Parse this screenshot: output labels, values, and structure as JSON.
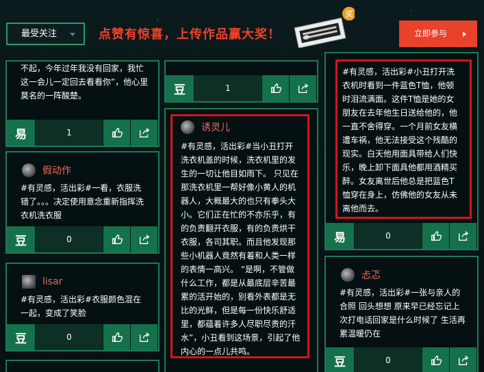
{
  "header": {
    "sort_label": "最受关注",
    "promo_text": "点赞有惊喜，上传作品赢大奖！",
    "prize_badge": "奖",
    "join_label": "立即参与"
  },
  "colors": {
    "accent_green": "#15704c",
    "border_green": "#1f7a55",
    "red": "#e8422b",
    "highlight": "#d4151d"
  },
  "cards": [
    {
      "id": "c1",
      "text": "不起，今年过年我没有回家，我忙这一会儿一定回去看看你”，他心里莫名的一阵酸楚。",
      "top_partial": "...",
      "count": "1",
      "logo": "易"
    },
    {
      "id": "c2",
      "user": "假动作",
      "text": "#有灵感，活出彩#一看，衣服洗错了。。。决定使用意念重新指挥洗衣机洗衣服",
      "count": "0",
      "logo": "豆"
    },
    {
      "id": "c3",
      "user": "lisar",
      "text": "#有灵感，活出彩#衣服颜色混在一起，变成了笑脸",
      "count": "0",
      "logo": "豆"
    },
    {
      "id": "c4",
      "count": "1",
      "logo": "豆"
    },
    {
      "id": "c5",
      "user": "诱灵儿",
      "text": "#有灵感，活出彩#当小丑打开洗衣机盖的时候，洗衣机里的发生的一切让他目如雨下。 只见在那洗衣机里一帮好像小黄人的机器人，大概最大的也只有拳头大小。它们正在忙的不亦乐乎，有的负责翻开衣服，有的负责烘干衣服，各司其职。而且他发现那些小机器人竟然有着和人类一样的表情一高兴。 “是啊，不管做什么工作，都是从最底层辛苦最累的活开始的，别看外表都是无比的光鲜，但是每一份快乐舒适里，都蕴着许多人尽职尽责的汗水”，小丑看到这场景，引起了他内心的一点儿共鸣。"
    },
    {
      "id": "c6",
      "text": "#有灵感，活出彩#小丑打开洗衣机时看到一件蓝色T恤，他顿时泪流满面。这件T恤是她的女朋友在去年他生日送给他的，他一直不舍得穿。一个月前女友横遭车祸，他无法接受这个残酷的现实。白天他用面具带给人们快乐，晚上卸下面具他都用酒精买醉。女友离世后他总是把蓝色T恤穿在身上，仿佛他的女友从未离他而去。",
      "count": "0",
      "logo": "易"
    },
    {
      "id": "c7",
      "user": "忐忑",
      "text": "#有灵感，活出彩#一张与亲人的合照 回头想想 原来早已经忘记上次打电话回家是什么时候了 生活再累温暖仍在",
      "count": "0",
      "logo": "豆"
    }
  ]
}
